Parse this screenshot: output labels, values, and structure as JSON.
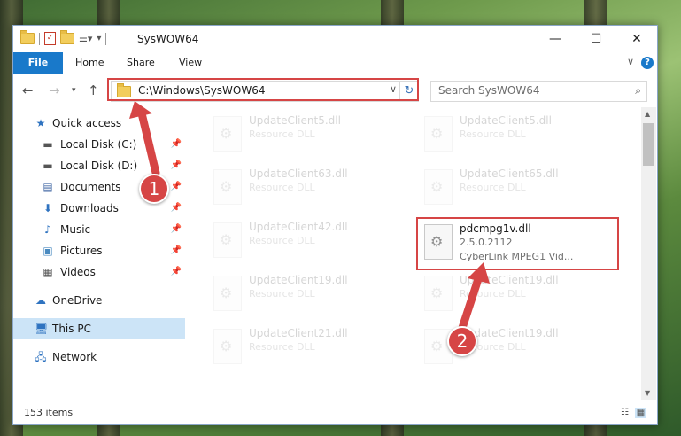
{
  "window": {
    "title": "SysWOW64"
  },
  "ribbon": {
    "tabs": [
      "File",
      "Home",
      "Share",
      "View"
    ]
  },
  "address": {
    "path": "C:\\Windows\\SysWOW64"
  },
  "search": {
    "placeholder": "Search SysWOW64"
  },
  "nav": {
    "items": [
      {
        "label": "Quick access",
        "icon": "star-icon"
      },
      {
        "label": "Local Disk (C:)",
        "icon": "drive-icon"
      },
      {
        "label": "Local Disk (D:)",
        "icon": "drive-icon"
      },
      {
        "label": "Documents",
        "icon": "documents-icon"
      },
      {
        "label": "Downloads",
        "icon": "downloads-icon"
      },
      {
        "label": "Music",
        "icon": "music-icon"
      },
      {
        "label": "Pictures",
        "icon": "pictures-icon"
      },
      {
        "label": "Videos",
        "icon": "videos-icon"
      },
      {
        "label": "OneDrive",
        "icon": "cloud-icon"
      },
      {
        "label": "This PC",
        "icon": "computer-icon"
      },
      {
        "label": "Network",
        "icon": "network-icon"
      }
    ]
  },
  "files": [
    {
      "name": "UpdateClient5.dll",
      "type": "Resource DLL"
    },
    {
      "name": "UpdateClient5.dll",
      "type": "Resource DLL"
    },
    {
      "name": "UpdateClient63.dll",
      "type": "Resource DLL"
    },
    {
      "name": "UpdateClient65.dll",
      "type": "Resource DLL"
    },
    {
      "name": "UpdateClient42.dll",
      "type": "Resource DLL"
    },
    {
      "name": "pdcmpg1v.dll",
      "type": "2.5.0.2112",
      "desc": "CyberLink MPEG1 Vid..."
    },
    {
      "name": "UpdateClient19.dll",
      "type": "Resource DLL"
    },
    {
      "name": "UpdateClient19.dll",
      "type": "Resource DLL"
    },
    {
      "name": "UpdateClient21.dll",
      "type": "Resource DLL"
    },
    {
      "name": "UpdateClient19.dll",
      "type": "Resource DLL"
    }
  ],
  "status": {
    "count": "153 items"
  },
  "callouts": [
    "1",
    "2"
  ],
  "colors": {
    "accent": "#1979ca",
    "highlight": "#d64545"
  }
}
